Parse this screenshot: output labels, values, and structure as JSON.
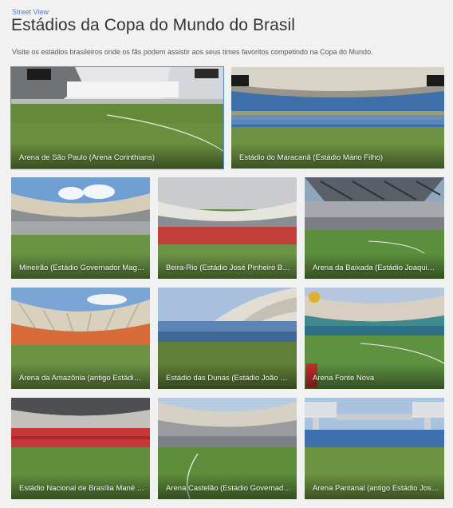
{
  "header": {
    "eyebrow": "Street View",
    "title": "Estádios da Copa do Mundo do Brasil",
    "subtitle": "Visite os estádios brasileiros onde os fãs podem assistir aos seus times favoritos competindo na Copa do Mundo."
  },
  "stadiums": [
    {
      "label": "Arena de São Paulo (Arena Corinthians)",
      "selected": true
    },
    {
      "label": "Estádio do Maracanã (Estádio Mário Filho)",
      "selected": false
    },
    {
      "label": "Mineirão (Estádio Governador Magalhães Pinto)",
      "selected": false
    },
    {
      "label": "Beira-Rio (Estádio José Pinheiro Borda)",
      "selected": false
    },
    {
      "label": "Arena da Baixada (Estádio Joaquim Américo Guimarães)",
      "selected": false
    },
    {
      "label": "Arena da Amazônia (antigo Estádio Vivaldo Lima)",
      "selected": false
    },
    {
      "label": "Estádio das Dunas (Estádio João Cláudio de Vasconcelos Machado)",
      "selected": false
    },
    {
      "label": "Arena Fonte Nova",
      "selected": false
    },
    {
      "label": "Estádio Nacional de Brasília Mané Garrincha",
      "selected": false
    },
    {
      "label": "Arena Castelão (Estádio Governador Plácido Castelo)",
      "selected": false
    },
    {
      "label": "Arena Pantanal (antigo Estádio José Fragelli)",
      "selected": false
    }
  ],
  "colors": {
    "accent": "#4d8ee0",
    "link": "#4a7fd1"
  }
}
